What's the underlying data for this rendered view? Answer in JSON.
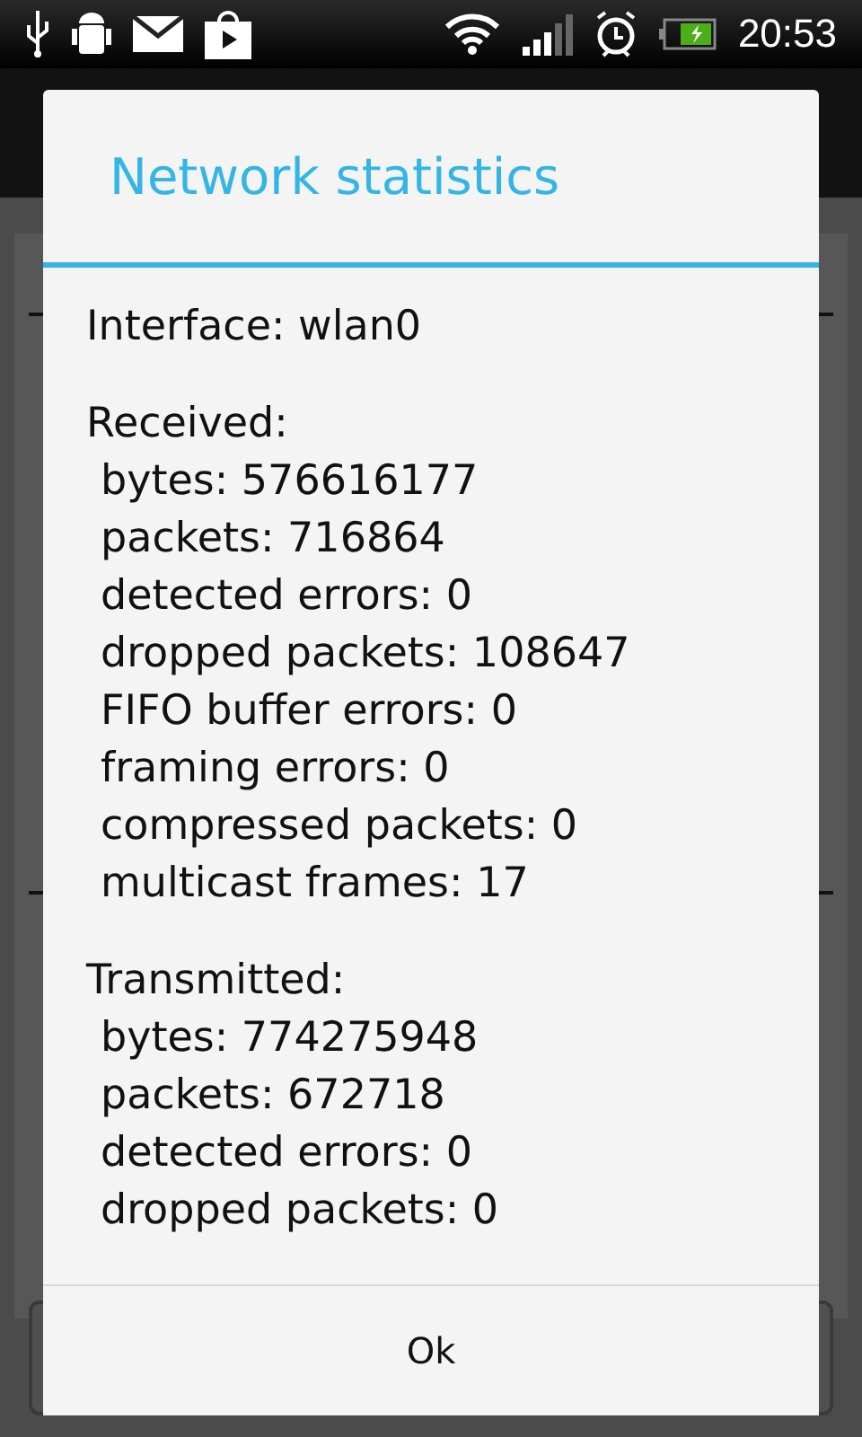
{
  "status_bar": {
    "time": "20:53"
  },
  "dialog": {
    "title": "Network statistics",
    "interface": "Interface: wlan0",
    "sections": [
      {
        "heading": "Received:",
        "items": [
          "bytes: 576616177",
          "packets: 716864",
          "detected errors: 0",
          "dropped packets: 108647",
          "FIFO buffer errors: 0",
          "framing errors: 0",
          "compressed packets: 0",
          "multicast frames: 17"
        ]
      },
      {
        "heading": "Transmitted:",
        "items": [
          "bytes: 774275948",
          "packets: 672718",
          "detected errors: 0",
          "dropped packets: 0"
        ]
      }
    ],
    "button": "Ok"
  }
}
